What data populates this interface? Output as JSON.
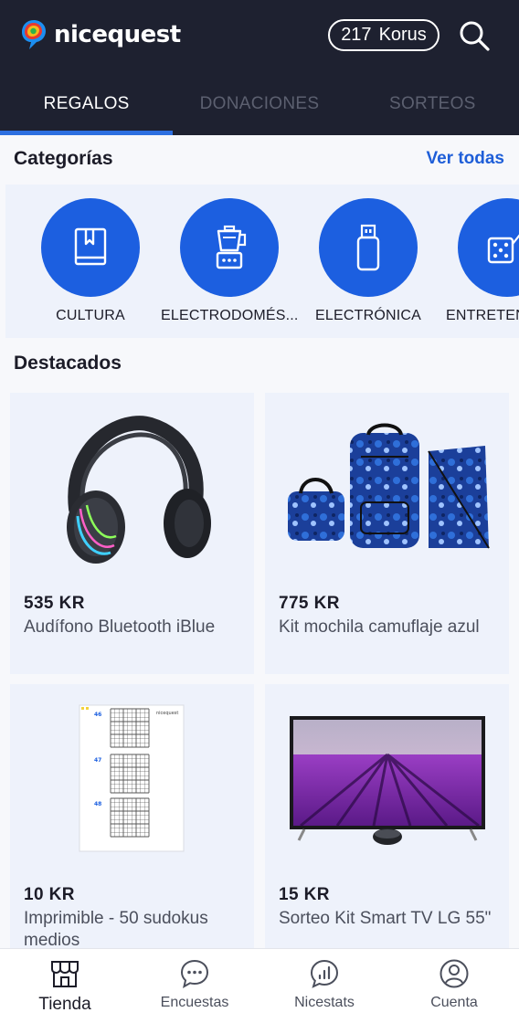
{
  "header": {
    "brand": "nicequest",
    "korus_amount": "217",
    "korus_unit": "Korus",
    "search_icon": "search-icon"
  },
  "tabs": [
    {
      "label": "REGALOS",
      "active": true
    },
    {
      "label": "DONACIONES",
      "active": false
    },
    {
      "label": "SORTEOS",
      "active": false
    }
  ],
  "categories": {
    "title": "Categorías",
    "see_all": "Ver todas",
    "items": [
      {
        "label": "CULTURA",
        "icon": "book-icon"
      },
      {
        "label": "ELECTRODOMÉS...",
        "icon": "blender-icon"
      },
      {
        "label": "ELECTRÓNICA",
        "icon": "usb-drive-icon"
      },
      {
        "label": "ENTRETENIMIENTO",
        "icon": "dice-icon"
      }
    ]
  },
  "featured": {
    "title": "Destacados",
    "items": [
      {
        "price": "535 KR",
        "name": "Audífono Bluetooth iBlue",
        "image": "headphones"
      },
      {
        "price": "775 KR",
        "name": "Kit mochila camuflaje azul",
        "image": "backpack-kit"
      },
      {
        "price": "10 KR",
        "name": "Imprimible - 50 sudokus medios",
        "image": "sudoku-sheet",
        "sheet_numbers": [
          "46",
          "47",
          "48"
        ],
        "sheet_brand": "nicequest"
      },
      {
        "price": "15 KR",
        "name": "Sorteo Kit Smart TV LG 55\"",
        "image": "smart-tv"
      }
    ]
  },
  "bottom_nav": [
    {
      "label": "Tienda",
      "icon": "store-icon",
      "active": true
    },
    {
      "label": "Encuestas",
      "icon": "chat-bubble-icon",
      "active": false
    },
    {
      "label": "Nicestats",
      "icon": "stats-bubble-icon",
      "active": false
    },
    {
      "label": "Cuenta",
      "icon": "user-icon",
      "active": false
    }
  ],
  "colors": {
    "header_bg": "#1e2130",
    "accent_blue": "#1c5fe0",
    "tab_indicator": "#2d6fe0",
    "card_bg": "#eef2fb"
  }
}
